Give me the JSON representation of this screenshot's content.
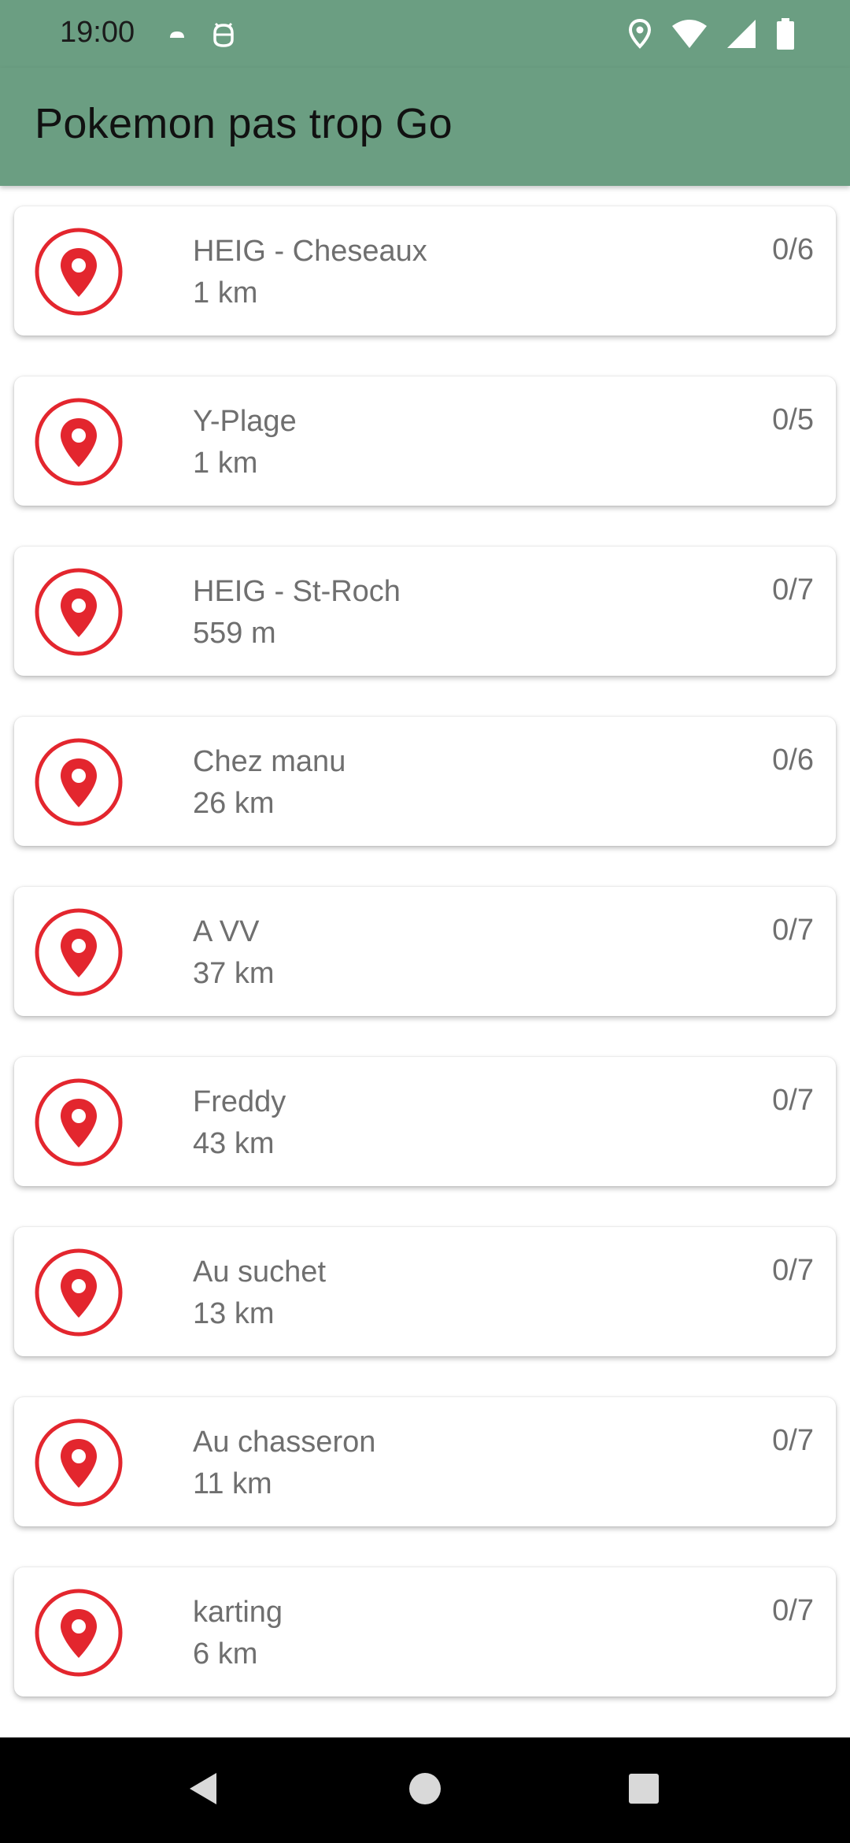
{
  "status_bar": {
    "time": "19:00",
    "left_icons": [
      "cloud-icon",
      "android-debug-icon"
    ],
    "right_icons": [
      "location-icon",
      "wifi-icon",
      "signal-icon",
      "battery-icon"
    ]
  },
  "app_bar": {
    "title": "Pokemon pas trop Go",
    "color": "#6b9e82"
  },
  "locations": [
    {
      "name": "HEIG - Cheseaux",
      "distance": "1 km",
      "count": "0/6"
    },
    {
      "name": "Y-Plage",
      "distance": "1 km",
      "count": "0/5"
    },
    {
      "name": "HEIG - St-Roch",
      "distance": "559 m",
      "count": "0/7"
    },
    {
      "name": "Chez manu",
      "distance": "26 km",
      "count": "0/6"
    },
    {
      "name": "A VV",
      "distance": "37 km",
      "count": "0/7"
    },
    {
      "name": "Freddy",
      "distance": "43 km",
      "count": "0/7"
    },
    {
      "name": "Au suchet",
      "distance": "13 km",
      "count": "0/7"
    },
    {
      "name": "Au chasseron",
      "distance": "11 km",
      "count": "0/7"
    },
    {
      "name": "karting",
      "distance": "6 km",
      "count": "0/7"
    }
  ],
  "pin_icon": "map-pin-icon",
  "accent_color": "#e3262e",
  "nav_bar": {
    "buttons": [
      "back-icon",
      "home-icon",
      "recents-icon"
    ]
  }
}
